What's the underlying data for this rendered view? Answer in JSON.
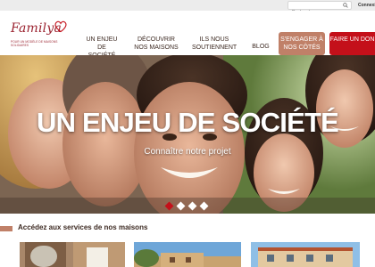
{
  "topbar": {
    "search_placeholder": "Recherche...",
    "connexion_label": "Connexion"
  },
  "logo": {
    "script_text": "Familya",
    "tagline": "POUR UN MODÈLE DE MAISONS SOLIDAIRES"
  },
  "nav": {
    "items": [
      {
        "label": "UN ENJEU DE SOCIÉTÉ"
      },
      {
        "label": "DÉCOUVRIR NOS MAISONS"
      },
      {
        "label": "ILS NOUS SOUTIENNENT"
      },
      {
        "label": "BLOG"
      }
    ],
    "engage_label": "S'ENGAGER À NOS CÔTÉS",
    "don_label": "FAIRE UN DON"
  },
  "hero": {
    "title": "UN ENJEU DE SOCIÉTÉ",
    "link": "Connaître notre projet",
    "slides_total": 4,
    "active_slide": 1
  },
  "services": {
    "heading": "Accédez aux services de nos maisons"
  },
  "colors": {
    "brand_red": "#c4101a",
    "accent_tan": "#c08068",
    "logo_red": "#9b2330",
    "text_dark": "#3d2a22"
  }
}
